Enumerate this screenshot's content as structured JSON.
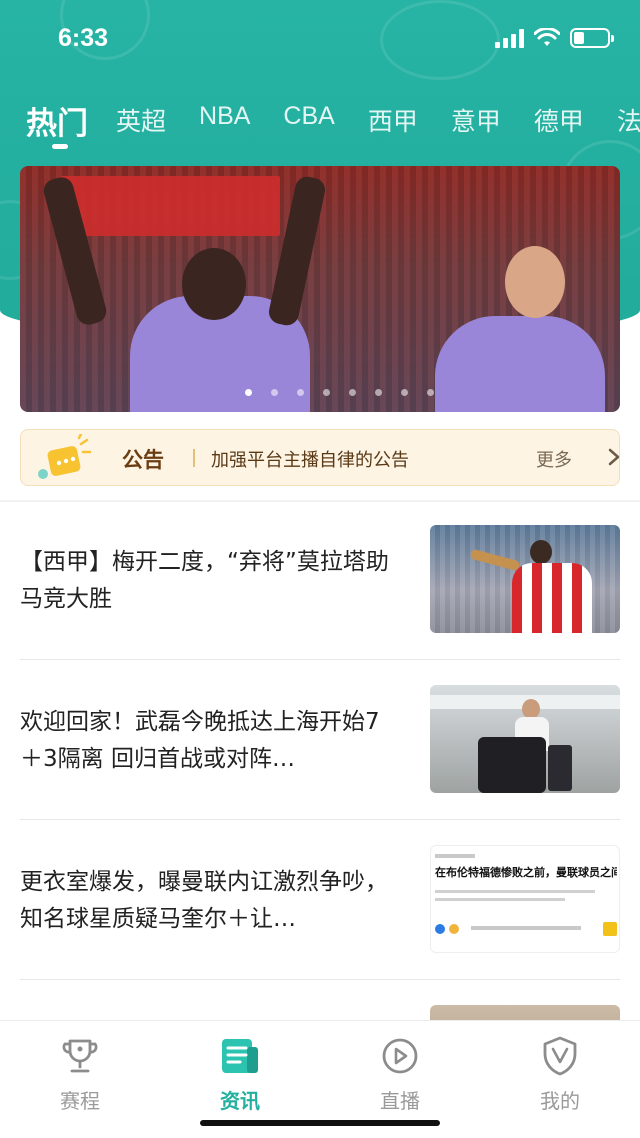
{
  "status_bar": {
    "time": "6:33"
  },
  "tabs": [
    {
      "label": "热门",
      "active": true
    },
    {
      "label": "英超"
    },
    {
      "label": "NBA"
    },
    {
      "label": "CBA"
    },
    {
      "label": "西甲"
    },
    {
      "label": "意甲"
    },
    {
      "label": "德甲"
    },
    {
      "label": "法"
    }
  ],
  "banner": {
    "dots_total": 8,
    "active_dot": 0
  },
  "notice": {
    "title": "公告",
    "text": "加强平台主播自律的公告",
    "more": "更多"
  },
  "news": [
    {
      "title": "【西甲】梅开二度，“弃将”莫拉塔助马竞大胜",
      "thumb": "player-red-white-jersey-19"
    },
    {
      "title": "欢迎回家！武磊今晚抵达上海开始7＋3隔离 回归首战或对阵…",
      "thumb": "airport-luggage"
    },
    {
      "title": "更衣室爆发，曝曼联内讧激烈争吵，知名球星质疑马奎尔＋让…",
      "thumb": "news-article-screenshot",
      "thumb_text": "在布伦特福德惨败之前，曼联球员之间爆发了更衣室争吵"
    },
    {
      "title": "",
      "thumb": "partial"
    }
  ],
  "bottom_nav": [
    {
      "label": "赛程",
      "icon": "trophy-icon"
    },
    {
      "label": "资讯",
      "icon": "news-icon",
      "active": true
    },
    {
      "label": "直播",
      "icon": "play-icon"
    },
    {
      "label": "我的",
      "icon": "profile-shield-icon"
    }
  ],
  "colors": {
    "brand": "#23b0a0",
    "notice_bg": "#fdf4e4"
  }
}
